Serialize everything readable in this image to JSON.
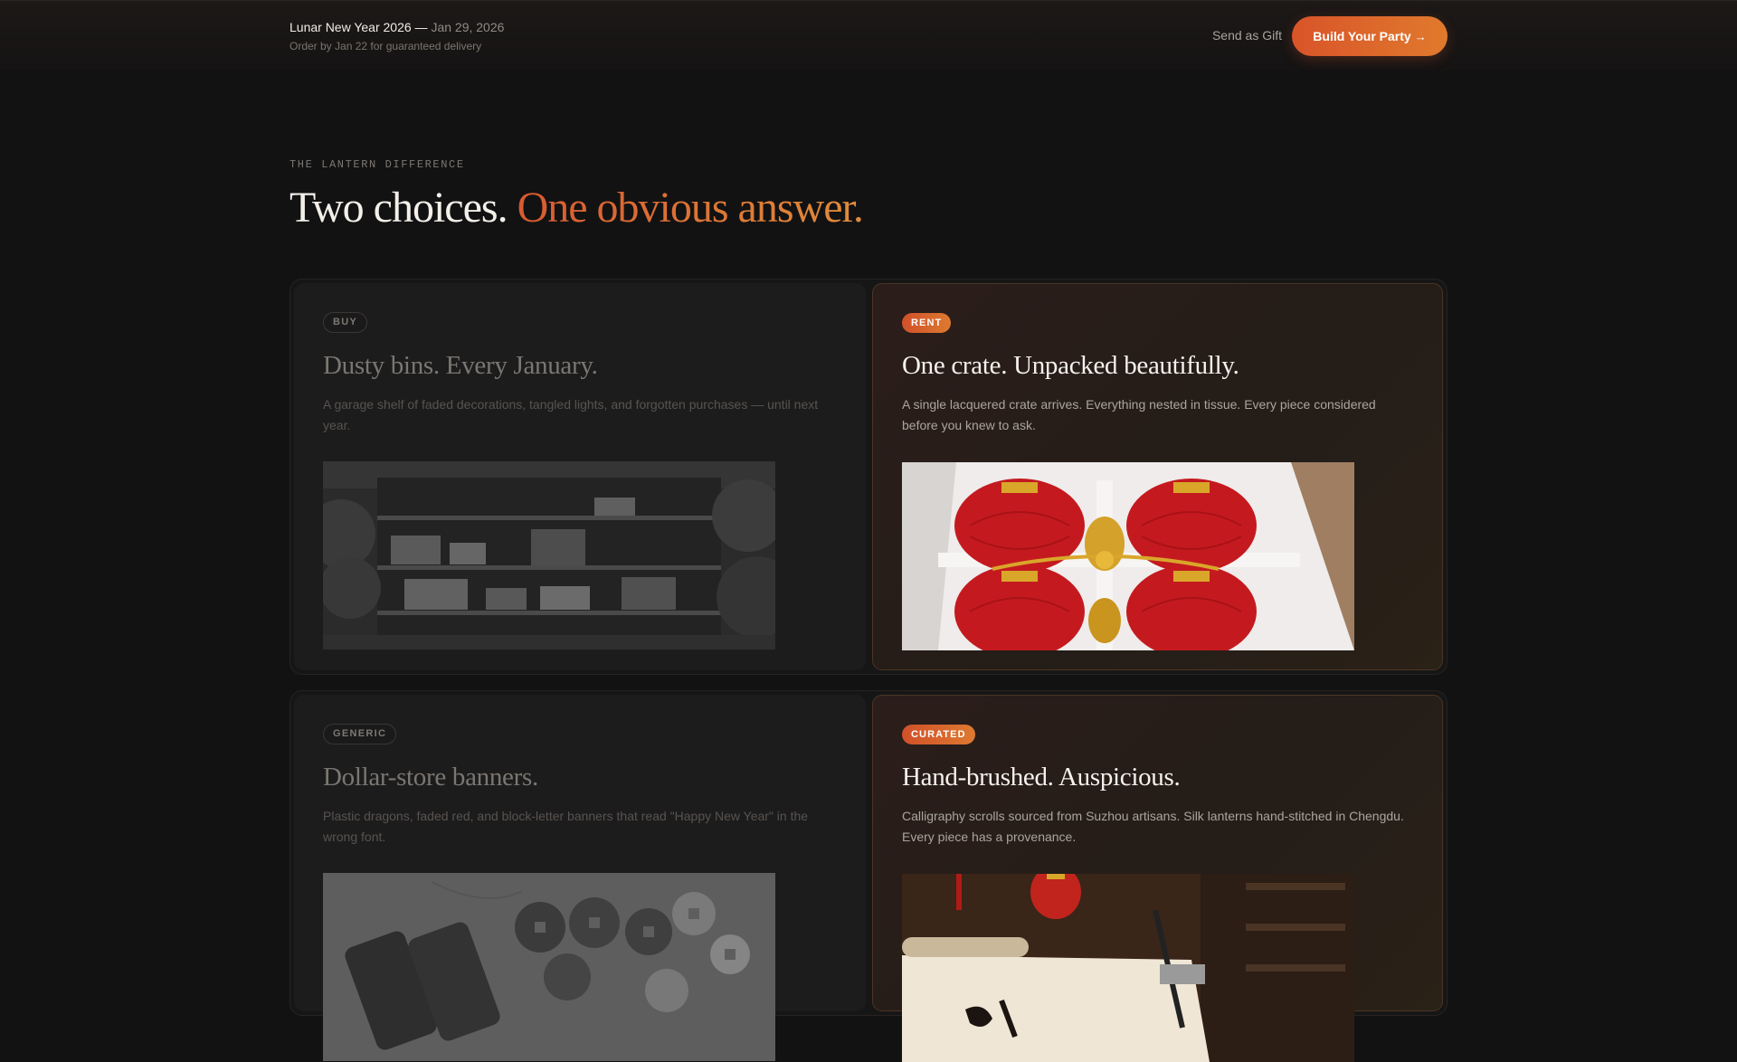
{
  "header": {
    "event_name": "Lunar New Year 2026 —",
    "event_date": "Jan 29, 2026",
    "delivery_note": "Order by Jan 22 for guaranteed delivery",
    "gift_link": "Send as Gift",
    "cta_label": "Build Your Party",
    "cta_arrow": "→"
  },
  "section": {
    "eyebrow": "THE LANTERN DIFFERENCE",
    "headline_main": "Two choices.",
    "headline_accent": "One obvious answer."
  },
  "comparisons": [
    {
      "left": {
        "tag": "BUY",
        "title": "Dusty bins. Every January.",
        "description": "A garage shelf of faded decorations, tangled lights, and forgotten purchases — until next year.",
        "image_icon": "garage-shelf-photo"
      },
      "right": {
        "tag": "RENT",
        "title": "One crate. Unpacked beautifully.",
        "description": "A single lacquered crate arrives. Everything nested in tissue. Every piece considered before you knew to ask.",
        "image_icon": "lantern-crate-photo"
      }
    },
    {
      "left": {
        "tag": "GENERIC",
        "title": "Dollar-store banners.",
        "description": "Plastic dragons, faded red, and block-letter banners that read \"Happy New Year\" in the wrong font.",
        "image_icon": "coins-photo"
      },
      "right": {
        "tag": "CURATED",
        "title": "Hand-brushed. Auspicious.",
        "description": "Calligraphy scrolls sourced from Suzhou artisans. Silk lanterns hand-stitched in Chengdu. Every piece has a provenance.",
        "image_icon": "calligraphy-scroll-photo"
      }
    }
  ],
  "colors": {
    "accent_start": "#d9542a",
    "accent_end": "#e07a2c",
    "background": "#121213"
  }
}
